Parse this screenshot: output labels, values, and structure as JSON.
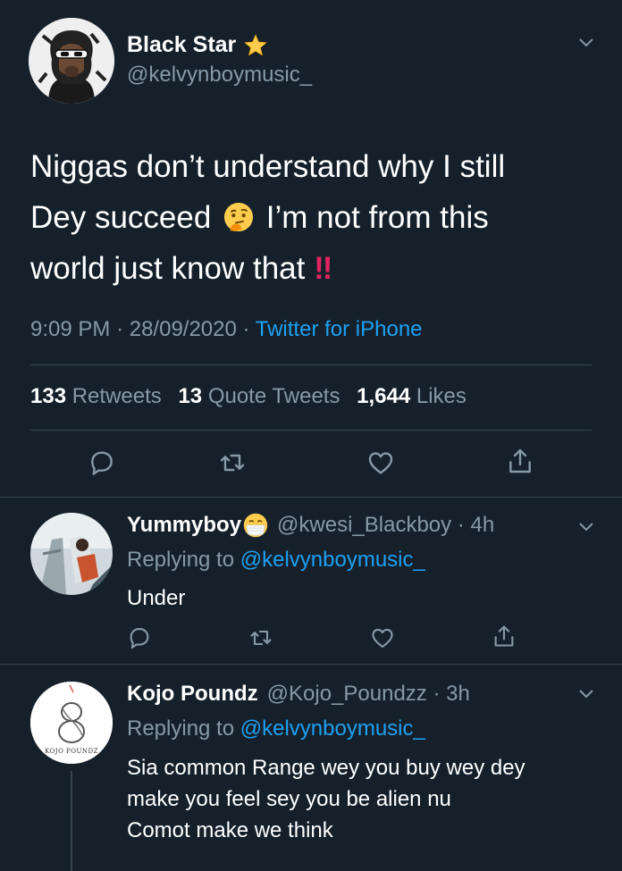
{
  "main_tweet": {
    "display_name": "Black Star",
    "handle": "@kelvynboymusic_",
    "text_line1": "Niggas don’t understand why I still",
    "text_line2a": "Dey succeed",
    "text_line2b": "I’m not from this",
    "text_line3a": "world just know that",
    "text_bangs": "!!",
    "time": "9:09 PM",
    "sep": "·",
    "date": "28/09/2020",
    "source": "Twitter for iPhone",
    "stats": {
      "retweets_count": "133",
      "retweets_label": "Retweets",
      "quotes_count": "13",
      "quotes_label": "Quote Tweets",
      "likes_count": "1,644",
      "likes_label": "Likes"
    }
  },
  "replies": [
    {
      "display_name": "Yummyboy",
      "handle_time": "@kwesi_Blackboy · 4h",
      "replying_prefix": "Replying to",
      "replying_to": "@kelvynboymusic_",
      "text": "Under"
    },
    {
      "display_name": "Kojo Poundz",
      "handle_time": "@Kojo_Poundzz · 3h",
      "replying_prefix": "Replying to",
      "replying_to": "@kelvynboymusic_",
      "text_line1": "Sia common Range wey you buy wey dey",
      "text_line2": "make you feel sey you be alien nu",
      "text_line3": "Comot make we think",
      "avatar_logo_text": "KOJO POUNDZ"
    }
  ],
  "colors": {
    "background": "#15202b",
    "secondary_text": "#8899a6",
    "link": "#1da1f2",
    "divider": "#38444d"
  },
  "icons": [
    "chevron-down-icon",
    "star-emoji-icon",
    "thinking-emoji-icon",
    "mask-emoji-icon",
    "reply-icon",
    "retweet-icon",
    "like-icon",
    "share-icon"
  ]
}
